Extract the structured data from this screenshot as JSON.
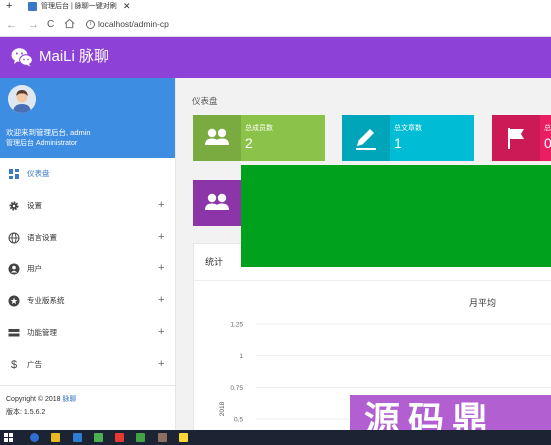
{
  "browser": {
    "new_tab": "+",
    "tab_title": "管理后台 | 脉聊一键对刷",
    "tab_close": "✕",
    "back": "←",
    "forward": "→",
    "reload": "C",
    "url": "localhost/admin-cp"
  },
  "header": {
    "brand": "MaiLi 脉聊",
    "brand_icon": "wechat-icon",
    "bg_color": "#8e41d6"
  },
  "sidebar": {
    "welcome": "欢迎来到管理后台, admin",
    "role": "管理后台 Administrator",
    "items": [
      {
        "label": "仪表盘",
        "icon": "dashboard-icon",
        "active": true,
        "expandable": false
      },
      {
        "label": "设置",
        "icon": "gear-icon",
        "active": false,
        "expandable": true,
        "expand": "+"
      },
      {
        "label": "语言设置",
        "icon": "globe-icon",
        "active": false,
        "expandable": true,
        "expand": "+"
      },
      {
        "label": "用户",
        "icon": "user-icon",
        "active": false,
        "expandable": true,
        "expand": "+"
      },
      {
        "label": "专业版系统",
        "icon": "star-icon",
        "active": false,
        "expandable": true,
        "expand": "+"
      },
      {
        "label": "功能管理",
        "icon": "table-icon",
        "active": false,
        "expandable": true,
        "expand": "+"
      },
      {
        "label": "广告",
        "icon": "dollar-icon",
        "active": false,
        "expandable": true,
        "expand": "+"
      }
    ],
    "copyright_prefix": "Copyright © 2018",
    "copyright_link": "脉聊",
    "version": "版本: 1.5.6.2"
  },
  "main": {
    "page_title": "仪表盘",
    "stats": [
      {
        "label": "总成员数",
        "value": "2",
        "icon": "users-icon",
        "color": "#8bc34a"
      },
      {
        "label": "总文章数",
        "value": "1",
        "icon": "pencil-icon",
        "color": "#00bcd4"
      },
      {
        "label": "总",
        "value": "0",
        "icon": "flag-icon",
        "color": "#e91e63"
      }
    ],
    "stat_row2_icon": "users-icon",
    "stat_row2_color": "#8b35a8",
    "panel_title": "统计"
  },
  "chart_data": {
    "type": "line",
    "title": "月平均",
    "ylabel": "2018",
    "y_ticks": [
      "1.25",
      "1",
      "0.75",
      "0.5"
    ],
    "ylim": [
      0.5,
      1.25
    ],
    "grid": true,
    "series": []
  },
  "watermark": {
    "text": "源码鼎"
  }
}
